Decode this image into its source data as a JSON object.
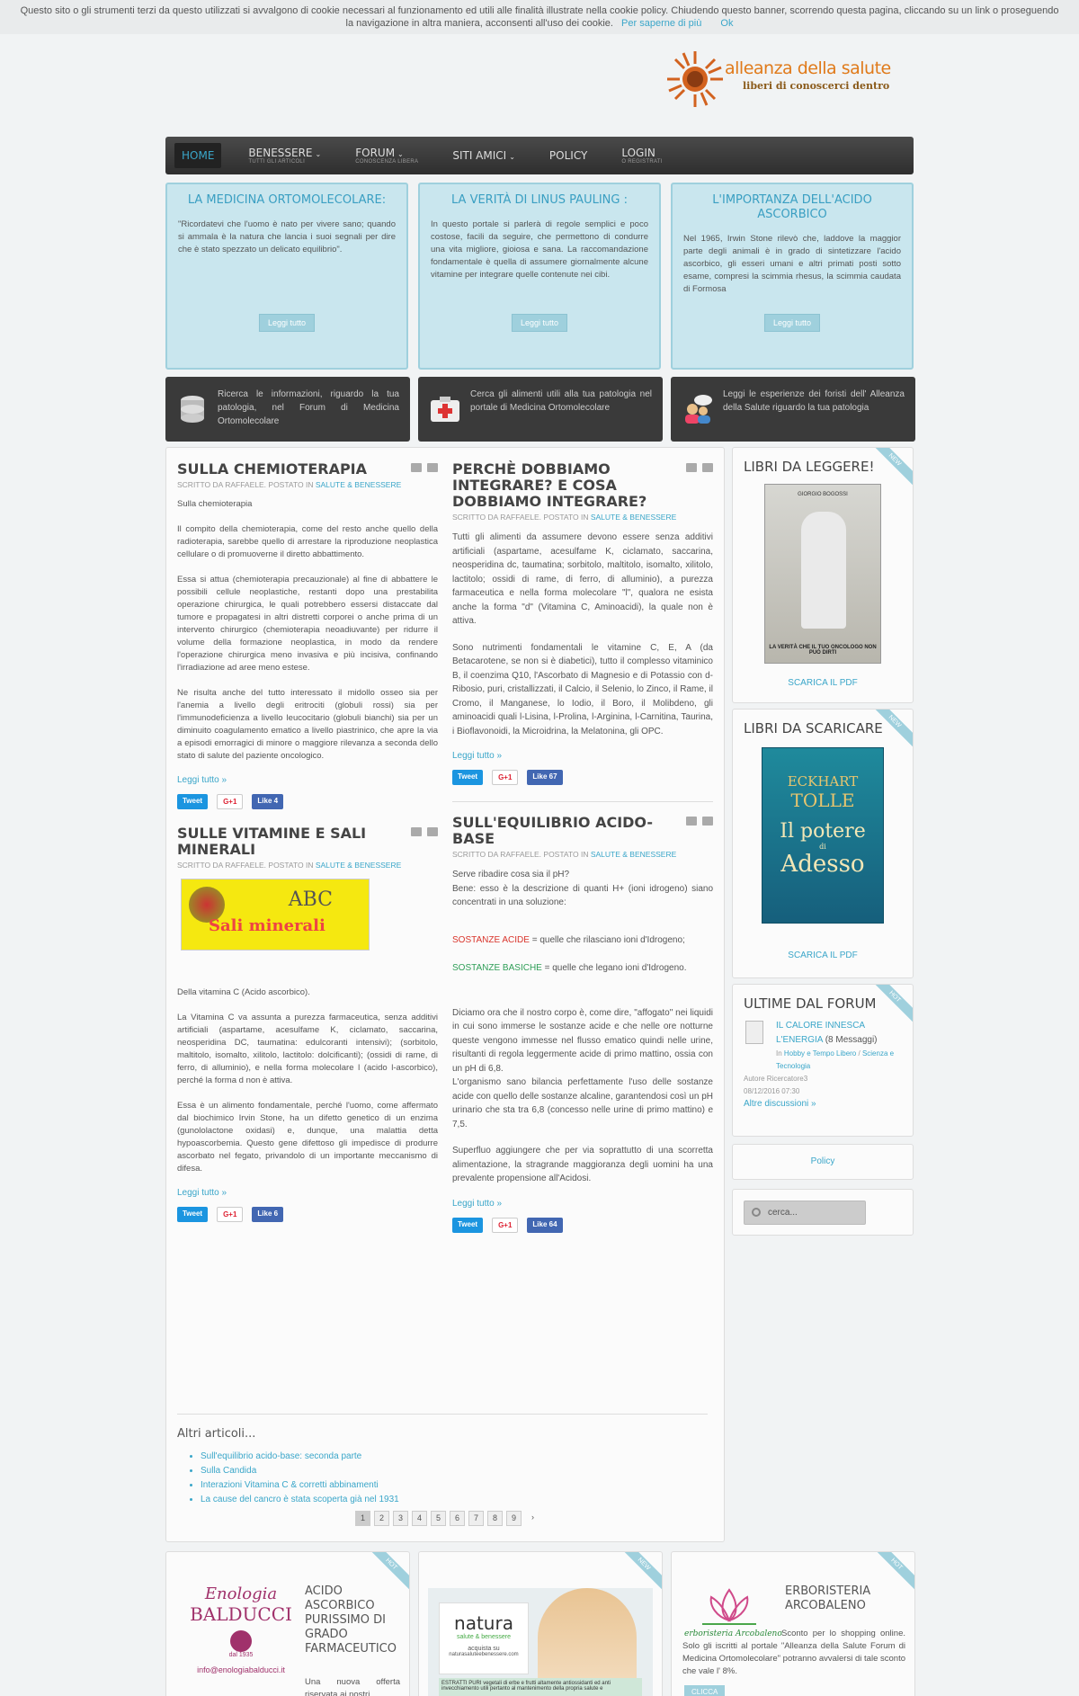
{
  "cookie": {
    "text": "Questo sito o gli strumenti terzi da questo utilizzati si avvalgono di cookie necessari al funzionamento ed utili alle finalità illustrate nella cookie policy. Chiudendo questo banner, scorrendo questa pagina, cliccando su un link o proseguendo la navigazione in altra maniera, acconsenti all'uso dei cookie.",
    "link": "Per saperne di più",
    "ok": "Ok"
  },
  "logo": {
    "name": "alleanza della salute",
    "tagline": "liberi di conoscerci dentro"
  },
  "nav": [
    {
      "label": "Home",
      "sub": ""
    },
    {
      "label": "Benessere",
      "sub": "Tutti gli articoli"
    },
    {
      "label": "Forum",
      "sub": "Conoscenza libera"
    },
    {
      "label": "Siti Amici",
      "sub": ""
    },
    {
      "label": "Policy",
      "sub": ""
    },
    {
      "label": "Login",
      "sub": "o registrati"
    }
  ],
  "promos": [
    {
      "title": "La Medicina Ortomolecolare:",
      "text": "\"Ricordatevi che l'uomo è nato per vivere sano; quando si ammala è la natura che lancia i suoi segnali per dire che è stato spezzato un delicato equilibrio\".",
      "button": "Leggi tutto"
    },
    {
      "title": "La verità di Linus Pauling :",
      "text": "In questo portale si parlerà di regole semplici e poco costose, facili da seguire, che permettono di condurre una vita migliore, gioiosa e sana. La raccomandazione fondamentale è quella di assumere giornalmente alcune vitamine per integrare quelle contenute nei cibi.",
      "button": "Leggi tutto"
    },
    {
      "title": "L'importanza dell'Acido Ascorbico",
      "text": "Nel 1965, Irwin Stone rilevò che, laddove la maggior parte degli animali è in grado di sintetizzare l'acido ascorbico, gli esseri umani e altri primati posti sotto esame, compresi la scimmia rhesus, la scimmia caudata di Formosa",
      "button": "Leggi tutto"
    }
  ],
  "darkboxes": [
    {
      "text": "Ricerca le informazioni, riguardo la tua patologia, nel Forum di Medicina Ortomolecolare",
      "icon": "database-icon"
    },
    {
      "text": "Cerca gli alimenti utili alla tua patologia nel portale di Medicina Ortomolecolare",
      "icon": "first-aid-icon"
    },
    {
      "text": "Leggi le esperienze dei foristi dell' Alleanza della Salute riguardo la tua patologia",
      "icon": "users-chat-icon"
    }
  ],
  "meta": {
    "written": "Scritto da Raffaele. Postato in",
    "category": "Salute & Benessere"
  },
  "articles": {
    "chemio": {
      "title": "Sulla Chemioterapia",
      "p0": "Sulla chemioterapia",
      "p1": "Il compito della chemioterapia, come del resto anche quello della radioterapia, sarebbe quello di arrestare la riproduzione neoplastica cellulare o di promuoverne il diretto abbattimento.",
      "p2": "Essa si attua (chemioterapia precauzionale) al fine di abbattere le possibili cellule neoplastiche, restanti dopo una prestabilita operazione chirurgica, le quali potrebbero essersi distaccate dal tumore e propagatesi in altri distretti corporei o anche prima di un intervento chirurgico (chemioterapia neoadiuvante) per ridurre il volume della formazione neoplastica, in modo da rendere l'operazione chirurgica meno invasiva e più incisiva, confinando l'irradiazione ad aree meno estese.",
      "p3": "Ne risulta anche del tutto interessato il midollo osseo sia per l'anemia a livello degli eritrociti (globuli rossi) sia per l'immunodeficienza a livello leucocitario (globuli bianchi) sia per un diminuito coagulamento ematico a livello piastrinico, che apre la via a episodi emorragici di minore o maggiore rilevanza a seconda dello stato di salute del paziente oncologico.",
      "read": "Leggi tutto »",
      "like": "Like 4"
    },
    "vitamine": {
      "title": "Sulle Vitamine e Sali Minerali",
      "img_top": "ABC",
      "img_bottom": "Sali minerali",
      "p0": "Della vitamina C (Acido ascorbico).",
      "p1": "La Vitamina C va assunta a purezza farmaceutica, senza additivi artificiali (aspartame, acesulfame K, ciclamato, saccarina, neosperidina DC, taumatina: edulcoranti intensivi); (sorbitolo, maltitolo, isomalto, xilitolo, lactitolo: dolcificanti); (ossidi di rame, di ferro, di alluminio), e nella forma molecolare l (acido l-ascorbico), perché la forma d non è attiva.",
      "p2": "Essa è un alimento fondamentale, perché l'uomo, come affermato dal biochimico Irvin Stone, ha un difetto genetico di un enzima (gunololactone oxidasi) e, dunque, una malattia detta hypoascorbemia. Questo gene difettoso gli impedisce di produrre ascorbato nel fegato, privandolo di un importante meccanismo di difesa.",
      "read": "Leggi tutto »",
      "like": "Like 6"
    },
    "integrare": {
      "title": "Perchè dobbiamo integrare? E cosa dobbiamo integrare?",
      "p1": "Tutti gli alimenti da assumere devono essere senza additivi artificiali (aspartame, acesulfame K, ciclamato, saccarina, neosperidina dc, taumatina; sorbitolo, maltitolo, isomalto, xilitolo, lactitolo; ossidi di rame, di ferro, di alluminio), a purezza farmaceutica e nella forma molecolare \"l\", qualora ne esista anche la forma \"d\" (Vitamina C, Aminoacidi), la quale non è attiva.",
      "p2": "Sono nutrimenti fondamentali le vitamine C, E, A (da Betacarotene, se non si è diabetici), tutto il complesso vitaminico B, il coenzima Q10, l'Ascorbato di Magnesio e di Potassio con d-Ribosio, puri, cristallizzati, il Calcio, il Selenio, lo Zinco, il Rame, il Cromo, il Manganese, lo Iodio, il Boro, il Molibdeno, gli aminoacidi quali l-Lisina, l-Prolina, l-Arginina, l-Carnitina, Taurina, i Bioflavonoidi, la Microidrina, la Melatonina, gli OPC.",
      "read": "Leggi tutto »",
      "like": "Like 67"
    },
    "equilibrio": {
      "title": "Sull'equilibrio acido-base",
      "p1a": "Serve ribadire cosa sia il pH?",
      "p1b": "Bene: esso è la descrizione di quanti H+ (ioni idrogeno) siano concentrati in una soluzione:",
      "acid_label": "SOSTANZE ACIDE",
      "acid_text": " = quelle che rilasciano ioni d'Idrogeno;",
      "base_label": "SOSTANZE BASICHE",
      "base_text": " = quelle che legano ioni d'Idrogeno.",
      "p2": "Diciamo ora che il nostro corpo è, come dire, \"affogato\" nei liquidi in cui sono immerse le sostanze acide e che nelle ore notturne queste vengono immesse nel flusso ematico quindi nelle urine, risultanti di regola leggermente acide di primo mattino, ossia con un pH di 6,8.",
      "p3": "L'organismo sano bilancia perfettamente l'uso delle sostanze acide con quello delle sostanze alcaline, garantendosi così un pH urinario che sta tra 6,8 (concesso nelle urine di primo mattino) e 7,5.",
      "p4": "Superfluo aggiungere che per via soprattutto di una scorretta alimentazione, la stragrande maggioranza degli uomini ha una prevalente propensione all'Acidosi.",
      "read": "Leggi tutto »",
      "like": "Like 64"
    }
  },
  "social": {
    "tweet": "Tweet",
    "gplus": "G+1"
  },
  "altri": {
    "title": "Altri articoli...",
    "items": [
      "Sull'equilibrio acido-base: seconda parte",
      "Sulla Candida",
      "Interazioni Vitamina C & corretti abbinamenti",
      "La cause del cancro è stata scoperta già nel 1931"
    ]
  },
  "pager": [
    "1",
    "2",
    "3",
    "4",
    "5",
    "6",
    "7",
    "8",
    "9",
    "›"
  ],
  "sidebar": {
    "libri": {
      "title": "Libri da leggere!",
      "ribbon": "NEW",
      "author": "GIORGIO BOGOSSI",
      "book_title": "LA VERITÀ CHE IL TUO ONCOLOGO NON PUÒ DIRTI",
      "link": "Scarica il PDF"
    },
    "scaricare": {
      "title": "Libri da scaricare",
      "ribbon": "NEW",
      "author1": "ECKHART",
      "author2": "TOLLE",
      "b1": "Il potere",
      "b2": "di",
      "b3": "Adesso",
      "link": "Scarica il PDF"
    },
    "forum": {
      "title": "Ultime dal forum",
      "ribbon": "HOT",
      "topic": "IL CALORE INNESCA L'ENERGIA",
      "count": "(8 Messaggi)",
      "in": "In",
      "cat1": "Hobby e Tempo Libero",
      "cat2": "Scienza e Tecnologia",
      "author": "Autore Ricercatore3",
      "date": "08/12/2016 07:30",
      "more": "Altre discussioni »"
    },
    "policy": "Policy",
    "search_placeholder": "cerca..."
  },
  "bottom": [
    {
      "ribbon": "HOT",
      "brand": "Enologia",
      "brand2": "BALDUCCI",
      "since": "dal 1935",
      "email": "info@enologiabalducci.it",
      "title": "Acido Ascorbico purissimo di grado farmaceutico",
      "text": "Una nuova offerta riservata ai nostri"
    },
    {
      "ribbon": "NEW",
      "brand": "natura",
      "brand2": "salute & benessere",
      "sub": "acquista su",
      "url": "naturasaluteebenessere.com",
      "banner": "ESTRATTI PURI vegetali di erbe e frutti altamente antiossidanti ed anti invecchiamento utili pertanto al mantenimento della propria salute e"
    },
    {
      "ribbon": "HOT",
      "brand": "erboristeria Arcobaleno",
      "title": "Erboristeria Arcobaleno",
      "text": "Sconto per lo shopping online. Solo gli iscritti al portale \"Alleanza della Salute Forum di Medicina Ortomolecolare\" potranno avvalersi di tale sconto che vale l' 8%.",
      "button": "CLICCA"
    }
  ],
  "colors": {
    "accent": "#3aa6c9",
    "promo_bg": "#c9e6ee",
    "nav_bg": "#333333",
    "acid": "#d9342b",
    "base": "#2f9e57"
  }
}
